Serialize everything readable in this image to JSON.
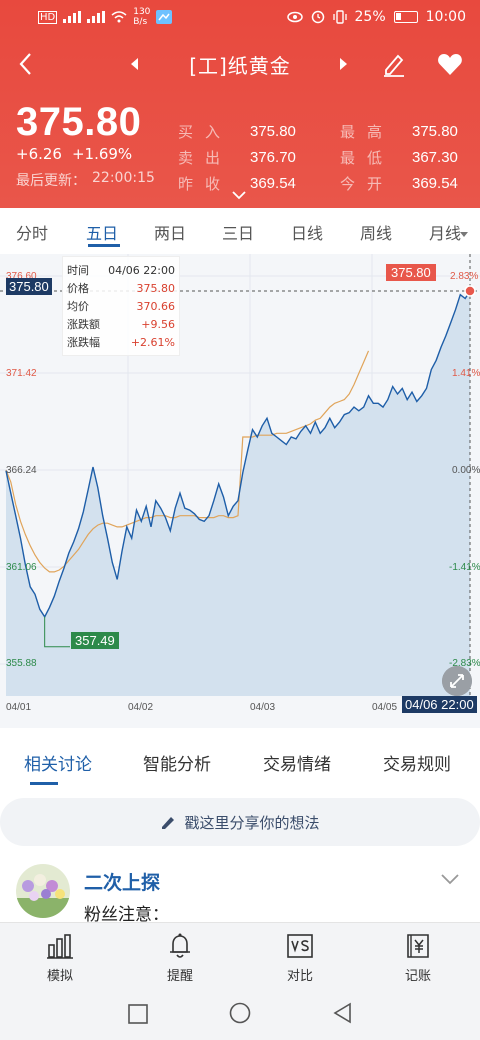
{
  "status_bar": {
    "network_speed_value": "130",
    "network_speed_unit": "B/s",
    "battery": "25%",
    "time": "10:00"
  },
  "header": {
    "title": "[工]纸黄金",
    "price": "375.80",
    "change": "+6.26",
    "change_pct": "+1.69%",
    "updated_label": "最后更新：",
    "updated_time": "22:00:15",
    "quotes": [
      {
        "label": "买入",
        "value": "375.80"
      },
      {
        "label": "卖出",
        "value": "376.70"
      },
      {
        "label": "昨收",
        "value": "369.54"
      },
      {
        "label": "最高",
        "value": "375.80"
      },
      {
        "label": "最低",
        "value": "367.30"
      },
      {
        "label": "今开",
        "value": "369.54"
      }
    ]
  },
  "tabs": [
    "分时",
    "五日",
    "两日",
    "三日",
    "日线",
    "周线",
    "月线"
  ],
  "active_tab": "五日",
  "tooltip": {
    "rows": [
      {
        "label": "时间",
        "value": "04/06 22:00"
      },
      {
        "label": "价格",
        "value": "375.80"
      },
      {
        "label": "均价",
        "value": "370.66"
      },
      {
        "label": "涨跌额",
        "value": "+9.56"
      },
      {
        "label": "涨跌幅",
        "value": "+2.61%"
      }
    ]
  },
  "chart_data": {
    "type": "line",
    "y_left_ticks": [
      "376.60",
      "371.42",
      "366.24",
      "361.06",
      "355.88"
    ],
    "y_right_ticks": [
      "2.83%",
      "1.41%",
      "0.00%",
      "-1.41%",
      "-2.83%"
    ],
    "x_ticks": [
      "04/01",
      "04/02",
      "04/03",
      "04/05"
    ],
    "ylim": [
      355.88,
      376.6
    ],
    "series": [
      {
        "values": [
          366.2,
          365.0,
          363.8,
          362.6,
          361.2,
          360.0,
          359.6,
          358.8,
          358.4,
          358.9,
          359.5,
          360.3,
          361.0,
          361.8,
          362.4,
          363.1,
          364.0,
          365.2,
          366.4,
          365.3,
          363.8,
          362.6,
          361.3,
          360.4,
          361.9,
          363.2,
          362.6,
          364.1,
          363.5,
          364.3,
          363.2,
          364.6,
          364.2,
          363.7,
          363.0,
          364.2,
          365.0,
          364.2,
          364.1,
          363.9,
          363.6,
          363.5,
          363.8,
          364.6,
          365.5,
          364.8,
          363.8,
          364.3,
          364.6,
          366.1,
          367.3,
          368.4,
          368.0,
          368.6,
          369.0,
          368.2,
          368.0,
          367.8,
          367.6,
          368.0,
          367.9,
          368.3,
          368.6,
          368.2,
          368.8,
          368.2,
          368.5,
          369.0,
          368.5,
          368.8,
          369.2,
          369.3,
          369.6,
          369.4,
          369.6,
          370.2,
          369.8,
          369.8,
          369.6,
          370.0,
          370.7,
          370.3,
          370.6,
          370.0,
          370.4,
          369.9,
          370.2,
          370.6,
          371.6,
          372.1,
          372.8,
          373.4,
          374.1,
          374.8,
          375.6,
          375.4,
          375.8
        ],
        "color": "#1e5ea8"
      },
      {
        "values": [
          366.24,
          365.6,
          364.4,
          363.5,
          362.8,
          362.2,
          361.7,
          361.3,
          361.0,
          360.8,
          360.8,
          360.9,
          361.1,
          361.4,
          361.7,
          362.0,
          362.4,
          362.8,
          363.1,
          363.3,
          363.4,
          363.4,
          363.3,
          363.2,
          363.2,
          363.3,
          363.4,
          363.5,
          363.6,
          363.7,
          363.7,
          363.8,
          363.8,
          363.8,
          363.7,
          363.7,
          363.8,
          363.8,
          363.8,
          363.8,
          363.7,
          363.7,
          363.7,
          363.7,
          363.8,
          363.8,
          363.7,
          363.7,
          363.8,
          368.0,
          368.0,
          368.0,
          368.1,
          368.1,
          368.1,
          368.1,
          368.2,
          368.2,
          368.2,
          368.3,
          368.4,
          368.5,
          368.6,
          368.7,
          368.9,
          369.0,
          369.3,
          369.6,
          369.8,
          369.9,
          370.0,
          370.3,
          370.8,
          371.4,
          372.0,
          372.6
        ],
        "color": "#e0a45a"
      }
    ],
    "annotations": {
      "high": "375.80",
      "low": "357.49",
      "current": "375.80",
      "cursor_time": "04/06 22:00"
    },
    "grid": true
  },
  "section_tabs": [
    "相关讨论",
    "智能分析",
    "交易情绪",
    "交易规则"
  ],
  "active_section_tab": "相关讨论",
  "share_placeholder": "戳这里分享你的想法",
  "post": {
    "author": "二次上探",
    "text": "粉丝注意："
  },
  "bottom_nav": [
    {
      "label": "模拟",
      "icon": "bar-chart-icon"
    },
    {
      "label": "提醒",
      "icon": "bell-icon"
    },
    {
      "label": "对比",
      "icon": "vs-icon"
    },
    {
      "label": "记账",
      "icon": "ledger-icon"
    }
  ],
  "colors": {
    "header_red": "#e8493e",
    "accent_blue": "#1f5fa8",
    "price_line": "#1e5ea8",
    "avg_line": "#e0a45a",
    "low_green": "#2d8a4a",
    "up_red": "#d9412f"
  }
}
